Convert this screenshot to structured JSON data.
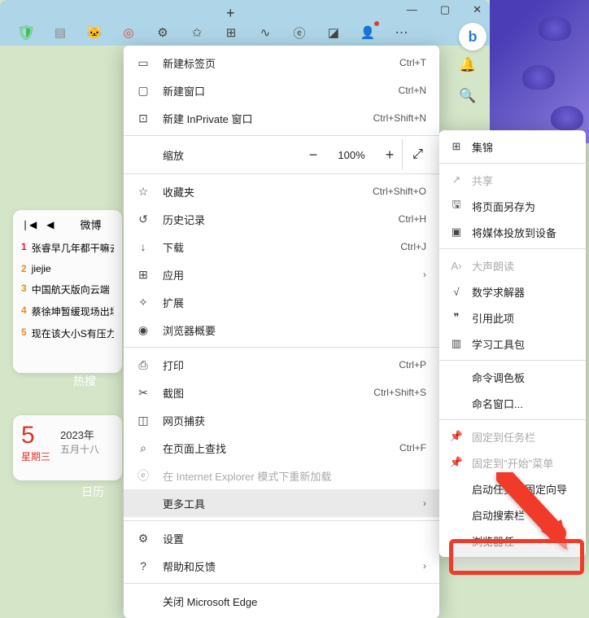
{
  "toolbar": {
    "plus": "+",
    "win_min": "—",
    "win_max": "▢",
    "win_close": "✕"
  },
  "side": {
    "bell": "🔔",
    "search": "🔍"
  },
  "menu": {
    "new_tab": {
      "label": "新建标签页",
      "shortcut": "Ctrl+T"
    },
    "new_window": {
      "label": "新建窗口",
      "shortcut": "Ctrl+N"
    },
    "new_inprivate": {
      "label": "新建 InPrivate 窗口",
      "shortcut": "Ctrl+Shift+N"
    },
    "zoom": {
      "label": "缩放",
      "value": "100%"
    },
    "favorites": {
      "label": "收藏夹",
      "shortcut": "Ctrl+Shift+O"
    },
    "history": {
      "label": "历史记录",
      "shortcut": "Ctrl+H"
    },
    "downloads": {
      "label": "下载",
      "shortcut": "Ctrl+J"
    },
    "apps": {
      "label": "应用"
    },
    "extensions": {
      "label": "扩展"
    },
    "browser_overview": {
      "label": "浏览器概要"
    },
    "print": {
      "label": "打印",
      "shortcut": "Ctrl+P"
    },
    "screenshot": {
      "label": "截图",
      "shortcut": "Ctrl+Shift+S"
    },
    "web_capture": {
      "label": "网页捕获"
    },
    "find": {
      "label": "在页面上查找",
      "shortcut": "Ctrl+F"
    },
    "ie_mode": {
      "label": "在 Internet Explorer 模式下重新加载"
    },
    "more_tools": {
      "label": "更多工具"
    },
    "settings": {
      "label": "设置"
    },
    "help": {
      "label": "帮助和反馈"
    },
    "close_edge": {
      "label": "关闭 Microsoft Edge"
    }
  },
  "submenu": {
    "collections": {
      "label": "集锦"
    },
    "share": {
      "label": "共享"
    },
    "save_page": {
      "label": "将页面另存为"
    },
    "cast": {
      "label": "将媒体投放到设备"
    },
    "read_aloud": {
      "label": "大声朗读"
    },
    "math_solver": {
      "label": "数学求解器"
    },
    "citations": {
      "label": "引用此项"
    },
    "learning_toolkit": {
      "label": "学习工具包"
    },
    "command_palette": {
      "label": "命令调色板"
    },
    "name_window": {
      "label": "命名窗口..."
    },
    "pin_taskbar": {
      "label": "固定到任务栏"
    },
    "pin_start": {
      "label": "固定到\"开始\"菜单"
    },
    "taskbar_wizard": {
      "label": "启动任务栏固定向导"
    },
    "search_bar": {
      "label": "启动搜索栏"
    },
    "browser_task": {
      "label": "浏览器任"
    }
  },
  "weibo": {
    "title": "微博",
    "items": [
      {
        "n": "1",
        "t": "张睿早几年都干嘛去"
      },
      {
        "n": "2",
        "t": "jiejie"
      },
      {
        "n": "3",
        "t": "中国航天版向云端"
      },
      {
        "n": "4",
        "t": "蔡徐坤暂缓现场出场"
      },
      {
        "n": "5",
        "t": "现在该大小S有压力"
      }
    ],
    "hot": "热搜"
  },
  "calendar": {
    "day": "5",
    "weekday": "星期三",
    "date": "2023年",
    "lunar": "五月十八",
    "label": "日历"
  }
}
